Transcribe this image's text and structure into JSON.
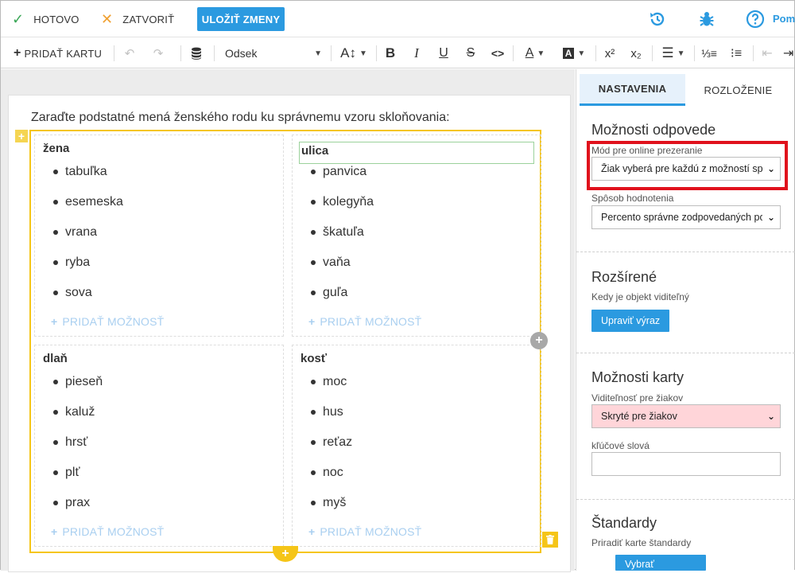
{
  "topbar": {
    "done_label": "HOTOVO",
    "close_label": "ZATVORIŤ",
    "save_label": "ULOŽIŤ ZMENY",
    "help_label": "Pom"
  },
  "toolbar": {
    "add_card_label": "PRIDAŤ KARTU",
    "paragraph_style": "Odsek"
  },
  "editor": {
    "question": "Zaraďte podstatné mená ženského rodu ku správnemu vzoru skloňovania:",
    "add_option_label": "PRIDAŤ MOŽNOSŤ",
    "cells": [
      {
        "title": "žena",
        "options": [
          "tabuľka",
          "esemeska",
          "vrana",
          "ryba",
          "sova"
        ]
      },
      {
        "title": "ulica",
        "options": [
          "panvica",
          "kolegyňa",
          "škatuľa",
          "vaňa",
          "guľa"
        ]
      },
      {
        "title": "dlaň",
        "options": [
          "pieseň",
          "kaluž",
          "hrsť",
          "plť",
          "prax"
        ]
      },
      {
        "title": "kosť",
        "options": [
          "moc",
          "hus",
          "reťaz",
          "noc",
          "myš"
        ]
      }
    ]
  },
  "panel": {
    "tabs": [
      {
        "label": "NASTAVENIA",
        "active": true
      },
      {
        "label": "ROZLOŽENIE",
        "active": false
      }
    ],
    "answer_options": {
      "title": "Možnosti odpovede",
      "mode_label": "Mód pre online prezeranie",
      "mode_value": "Žiak vyberá pre každú z možností sp",
      "grading_label": "Spôsob hodnotenia",
      "grading_value": "Percento správne zodpovedaných pc"
    },
    "advanced": {
      "title": "Rozšírené",
      "visibility_text": "Kedy je objekt viditeľný",
      "edit_button": "Upraviť výraz"
    },
    "card_options": {
      "title": "Možnosti karty",
      "visibility_label": "Viditeľnosť pre žiakov",
      "visibility_value": "Skryté pre žiakov",
      "keywords_label": "kľúčové slová",
      "keywords_value": ""
    },
    "standards": {
      "title": "Štandardy",
      "assign_text": "Priradiť karte štandardy",
      "select_button": "Vybrať štandardy"
    }
  },
  "colors": {
    "accent": "#2b9ae0",
    "card_frame": "#f5c518",
    "highlight": "#e0111c",
    "hidden_select_bg": "#ffd5d9"
  }
}
